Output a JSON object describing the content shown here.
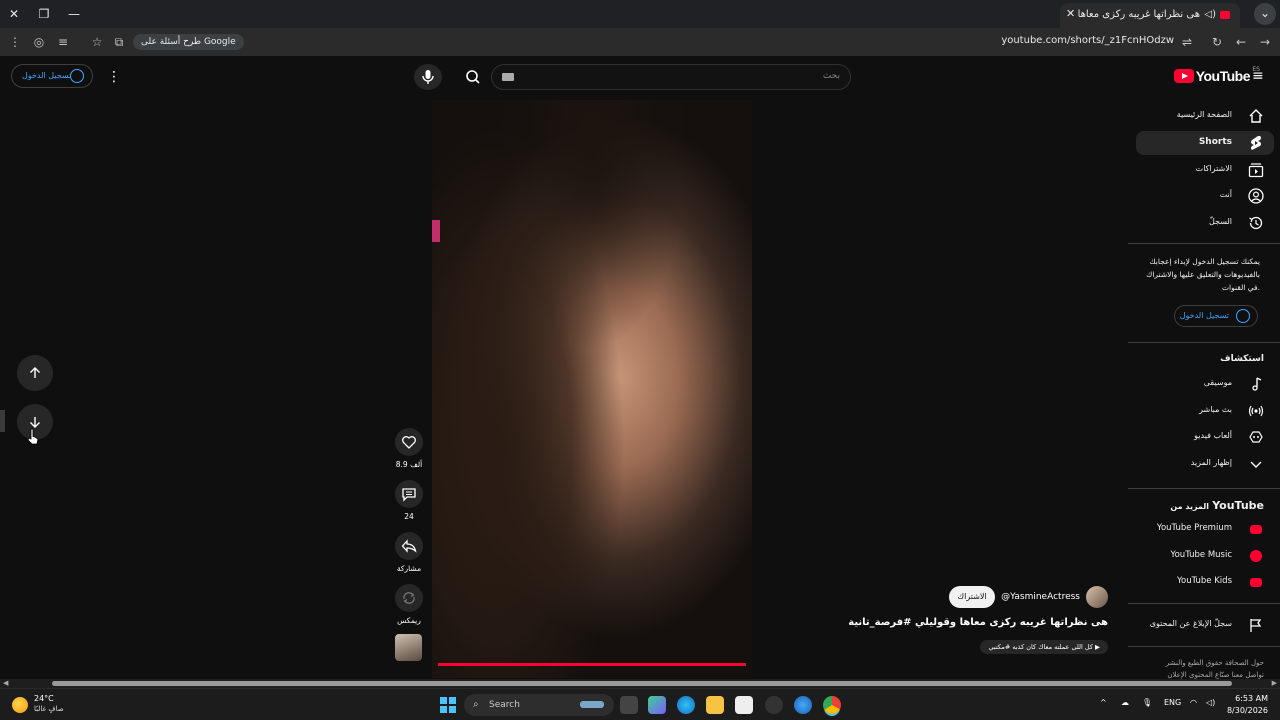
{
  "browser": {
    "tab_title": "هى نظراتها غريبه ركزى معاها",
    "url": "youtube.com/shorts/_z1FcnHOdzw",
    "google_pill": "طرح أسئلة على Google"
  },
  "masthead": {
    "logo_text": "YouTube",
    "country_code": "ES",
    "search_placeholder": "بحث",
    "signin_label": "تسجيل الدخول"
  },
  "sidebar": {
    "items": [
      {
        "label": "الصفحة الرئيسية",
        "icon": "home-icon"
      },
      {
        "label": "Shorts",
        "icon": "shorts-icon",
        "active": true
      },
      {
        "label": "الاشتراكات",
        "icon": "subscriptions-icon"
      },
      {
        "label": "أنت",
        "icon": "you-icon"
      },
      {
        "label": "السجلّ",
        "icon": "history-icon"
      }
    ],
    "signin_prompt_line1": "يمكنك تسجيل الدخول لإبداء إعجابك",
    "signin_prompt_line2": "بالفيديوهات والتعليق عليها والاشتراك",
    "signin_prompt_line3": "في القنوات.",
    "signin_button": "تسجيل الدخول",
    "explore_title": "استكشاف",
    "explore": [
      {
        "label": "موسيقى",
        "icon": "music-icon"
      },
      {
        "label": "بث مباشر",
        "icon": "live-icon"
      },
      {
        "label": "ألعاب فيديو",
        "icon": "gaming-icon"
      },
      {
        "label": "إظهار المزيد",
        "icon": "chevron-down-icon"
      }
    ],
    "more_title_prefix": "المزيد من",
    "more_title_brand": "YouTube",
    "more": [
      {
        "label": "YouTube Premium"
      },
      {
        "label": "YouTube Music"
      },
      {
        "label": "YouTube Kids"
      }
    ],
    "report_history": "سجلّ الإبلاغ عن المحتوى",
    "footer_line1": "حول  الصحافة  حقوق الطبع والنشر",
    "footer_line2": "تواصل معنا  صنّاع المحتوى  الإعلان"
  },
  "short": {
    "channel_handle": "@YasmineActress",
    "subscribe_label": "الاشتراك",
    "title": "هى نظراتها غريبه ركزى معاها وقوليلي #فرصة_تانية",
    "sound_label": "كل اللى عملته معاك كان كذبه #مكتبي",
    "progress": 0.998,
    "likes": "8.9 ألف",
    "comments": "24",
    "share_label": "مشاركة",
    "remix_label": "ريمكس"
  },
  "taskbar": {
    "temperature": "24°C",
    "weather_desc": "صافٍ غالبًا",
    "search_label": "Search",
    "language": "ENG",
    "time": "6:53 AM",
    "date": "8/30/2026"
  }
}
